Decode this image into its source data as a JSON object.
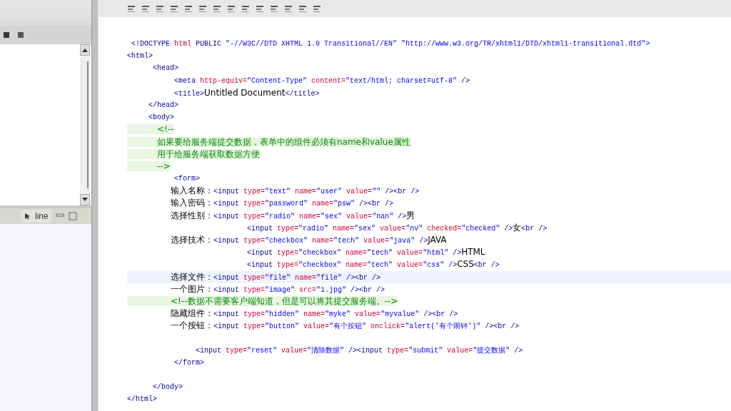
{
  "sidebar": {
    "panel_tab": {
      "label": "line",
      "selected": true
    }
  },
  "editor": {
    "lines": [
      {
        "current": false,
        "tokens": [
          {
            "kind": "tag",
            "text": " <!DOCTYPE "
          },
          {
            "kind": "attr",
            "text": "html "
          },
          {
            "kind": "tag",
            "text": "PUBLIC "
          },
          {
            "kind": "value",
            "text": "\"-//W3C//DTD XHTML 1.0 Transitional//EN\" \"http://www.w3.org/TR/xhtml1/DTD/xhtml1-transitional.dtd\">"
          }
        ]
      },
      {
        "current": false,
        "tokens": [
          {
            "kind": "tag",
            "text": "<html>"
          }
        ]
      },
      {
        "current": false,
        "tokens": [
          {
            "kind": "tag",
            "text": "      <head>"
          }
        ]
      },
      {
        "current": false,
        "tokens": [
          {
            "kind": "tag",
            "text": "           <meta "
          },
          {
            "kind": "attr",
            "text": "http-equiv="
          },
          {
            "kind": "value",
            "text": "\"Content-Type\" "
          },
          {
            "kind": "attr",
            "text": "content="
          },
          {
            "kind": "value",
            "text": "\"text/html; charset=utf-8\" "
          },
          {
            "kind": "tag",
            "text": "/>"
          }
        ]
      },
      {
        "current": false,
        "tokens": [
          {
            "kind": "tag",
            "text": "           <title>"
          },
          {
            "kind": "text",
            "text": "Untitled Document"
          },
          {
            "kind": "tag",
            "text": "</title>"
          }
        ]
      },
      {
        "current": false,
        "tokens": [
          {
            "kind": "tag",
            "text": "     </head>"
          }
        ]
      },
      {
        "current": false,
        "tokens": [
          {
            "kind": "tag",
            "text": "     <body>"
          }
        ]
      },
      {
        "current": false,
        "tokens": [
          {
            "kind": "comment",
            "text": "           <!--"
          }
        ]
      },
      {
        "current": false,
        "tokens": [
          {
            "kind": "comment",
            "text": "           如果要给服务端提交数据，表单中的组件必须有name和value属性"
          }
        ]
      },
      {
        "current": false,
        "tokens": [
          {
            "kind": "comment",
            "text": "           用于给服务端获取数据方便"
          }
        ]
      },
      {
        "current": false,
        "tokens": [
          {
            "kind": "comment",
            "text": "           -->"
          }
        ]
      },
      {
        "current": false,
        "tokens": [
          {
            "kind": "tag",
            "text": "           <form>"
          }
        ]
      },
      {
        "current": false,
        "tokens": [
          {
            "kind": "text",
            "text": "                输入名称："
          },
          {
            "kind": "tag",
            "text": "<input "
          },
          {
            "kind": "attr",
            "text": "type="
          },
          {
            "kind": "value",
            "text": "\"text\" "
          },
          {
            "kind": "attr",
            "text": "name="
          },
          {
            "kind": "value",
            "text": "\"user\" "
          },
          {
            "kind": "attr",
            "text": "value="
          },
          {
            "kind": "value",
            "text": "\"\" "
          },
          {
            "kind": "tag",
            "text": "/><br />"
          }
        ]
      },
      {
        "current": false,
        "tokens": [
          {
            "kind": "text",
            "text": "                输入密码："
          },
          {
            "kind": "tag",
            "text": "<input "
          },
          {
            "kind": "attr",
            "text": "type="
          },
          {
            "kind": "value",
            "text": "\"password\" "
          },
          {
            "kind": "attr",
            "text": "name="
          },
          {
            "kind": "value",
            "text": "\"psw\" "
          },
          {
            "kind": "tag",
            "text": "/><br />"
          }
        ]
      },
      {
        "current": false,
        "tokens": [
          {
            "kind": "text",
            "text": "                选择性别："
          },
          {
            "kind": "tag",
            "text": "<input "
          },
          {
            "kind": "attr",
            "text": "type="
          },
          {
            "kind": "value",
            "text": "\"radio\" "
          },
          {
            "kind": "attr",
            "text": "name="
          },
          {
            "kind": "value",
            "text": "\"sex\" "
          },
          {
            "kind": "attr",
            "text": "value="
          },
          {
            "kind": "value",
            "text": "\"nan\" "
          },
          {
            "kind": "tag",
            "text": "/>"
          },
          {
            "kind": "text",
            "text": "男"
          }
        ]
      },
      {
        "current": false,
        "tokens": [
          {
            "kind": "tag",
            "text": "                            <input "
          },
          {
            "kind": "attr",
            "text": "type="
          },
          {
            "kind": "value",
            "text": "\"radio\" "
          },
          {
            "kind": "attr",
            "text": "name="
          },
          {
            "kind": "value",
            "text": "\"sex\" "
          },
          {
            "kind": "attr",
            "text": "value="
          },
          {
            "kind": "value",
            "text": "\"nv\" "
          },
          {
            "kind": "attr",
            "text": "checked="
          },
          {
            "kind": "value",
            "text": "\"checked\" "
          },
          {
            "kind": "tag",
            "text": "/>"
          },
          {
            "kind": "text",
            "text": "女"
          },
          {
            "kind": "tag",
            "text": "<br />"
          }
        ]
      },
      {
        "current": false,
        "tokens": [
          {
            "kind": "text",
            "text": "                选择技术："
          },
          {
            "kind": "tag",
            "text": "<input "
          },
          {
            "kind": "attr",
            "text": "type="
          },
          {
            "kind": "value",
            "text": "\"checkbox\" "
          },
          {
            "kind": "attr",
            "text": "name="
          },
          {
            "kind": "value",
            "text": "\"tech\" "
          },
          {
            "kind": "attr",
            "text": "value="
          },
          {
            "kind": "value",
            "text": "\"java\" "
          },
          {
            "kind": "tag",
            "text": "/>"
          },
          {
            "kind": "text",
            "text": "JAVA"
          }
        ]
      },
      {
        "current": false,
        "tokens": [
          {
            "kind": "tag",
            "text": "                            <input "
          },
          {
            "kind": "attr",
            "text": "type="
          },
          {
            "kind": "value",
            "text": "\"checkbox\" "
          },
          {
            "kind": "attr",
            "text": "name="
          },
          {
            "kind": "value",
            "text": "\"tech\" "
          },
          {
            "kind": "attr",
            "text": "value="
          },
          {
            "kind": "value",
            "text": "\"html\" "
          },
          {
            "kind": "tag",
            "text": "/>"
          },
          {
            "kind": "text",
            "text": "HTML"
          }
        ]
      },
      {
        "current": false,
        "tokens": [
          {
            "kind": "tag",
            "text": "                            <input "
          },
          {
            "kind": "attr",
            "text": "type="
          },
          {
            "kind": "value",
            "text": "\"checkbox\" "
          },
          {
            "kind": "attr",
            "text": "name="
          },
          {
            "kind": "value",
            "text": "\"tech\" "
          },
          {
            "kind": "attr",
            "text": "value="
          },
          {
            "kind": "value",
            "text": "\"css\" "
          },
          {
            "kind": "tag",
            "text": "/>"
          },
          {
            "kind": "text",
            "text": "CSS"
          },
          {
            "kind": "tag",
            "text": "<br />"
          }
        ]
      },
      {
        "current": true,
        "tokens": [
          {
            "kind": "text",
            "text": "                选择文件："
          },
          {
            "kind": "tag",
            "text": "<input "
          },
          {
            "kind": "attr",
            "text": "type="
          },
          {
            "kind": "value",
            "text": "\"file\" "
          },
          {
            "kind": "attr",
            "text": "name="
          },
          {
            "kind": "value",
            "text": "\"file\" "
          },
          {
            "kind": "tag",
            "text": "/><br />"
          }
        ]
      },
      {
        "current": false,
        "tokens": [
          {
            "kind": "text",
            "text": "                一个图片："
          },
          {
            "kind": "tag",
            "text": "<input "
          },
          {
            "kind": "attr",
            "text": "type="
          },
          {
            "kind": "value",
            "text": "\"image\" "
          },
          {
            "kind": "attr",
            "text": "src="
          },
          {
            "kind": "value",
            "text": "\"1.jpg\" "
          },
          {
            "kind": "tag",
            "text": "/><br />"
          }
        ]
      },
      {
        "current": false,
        "tokens": [
          {
            "kind": "comment",
            "text": "                <!--数据不需要客户端知道，但是可以将其提交服务端。-->"
          }
        ]
      },
      {
        "current": false,
        "tokens": [
          {
            "kind": "text",
            "text": "                隐藏组件："
          },
          {
            "kind": "tag",
            "text": "<input "
          },
          {
            "kind": "attr",
            "text": "type="
          },
          {
            "kind": "value",
            "text": "\"hidden\" "
          },
          {
            "kind": "attr",
            "text": "name="
          },
          {
            "kind": "value",
            "text": "\"myke\" "
          },
          {
            "kind": "attr",
            "text": "value="
          },
          {
            "kind": "value",
            "text": "\"myvalue\" "
          },
          {
            "kind": "tag",
            "text": "/><br />"
          }
        ]
      },
      {
        "current": false,
        "tokens": [
          {
            "kind": "text",
            "text": "                一个按钮："
          },
          {
            "kind": "tag",
            "text": "<input "
          },
          {
            "kind": "attr",
            "text": "type="
          },
          {
            "kind": "value",
            "text": "\"button\" "
          },
          {
            "kind": "attr",
            "text": "value="
          },
          {
            "kind": "value",
            "text": "\"有个按钮\" "
          },
          {
            "kind": "attr",
            "text": "onclick="
          },
          {
            "kind": "value",
            "text": "\"alert('有个闹钟')\" "
          },
          {
            "kind": "tag",
            "text": "/><br />"
          }
        ]
      },
      {
        "current": false,
        "spaced_above": true,
        "tokens": [
          {
            "kind": "tag",
            "text": "                <input "
          },
          {
            "kind": "attr",
            "text": "type="
          },
          {
            "kind": "value",
            "text": "\"reset\" "
          },
          {
            "kind": "attr",
            "text": "value="
          },
          {
            "kind": "value",
            "text": "\"清除数据\" "
          },
          {
            "kind": "tag",
            "text": "/><input "
          },
          {
            "kind": "attr",
            "text": "type="
          },
          {
            "kind": "value",
            "text": "\"submit\" "
          },
          {
            "kind": "attr",
            "text": "value="
          },
          {
            "kind": "value",
            "text": "\"提交数据\" "
          },
          {
            "kind": "tag",
            "text": "/>"
          }
        ]
      },
      {
        "current": false,
        "tokens": [
          {
            "kind": "tag",
            "text": "           </form>"
          }
        ]
      },
      {
        "current": false,
        "spaced_above": true,
        "tokens": [
          {
            "kind": "tag",
            "text": "      </body>"
          }
        ]
      },
      {
        "current": false,
        "tokens": [
          {
            "kind": "tag",
            "text": "</html>"
          }
        ]
      }
    ]
  }
}
